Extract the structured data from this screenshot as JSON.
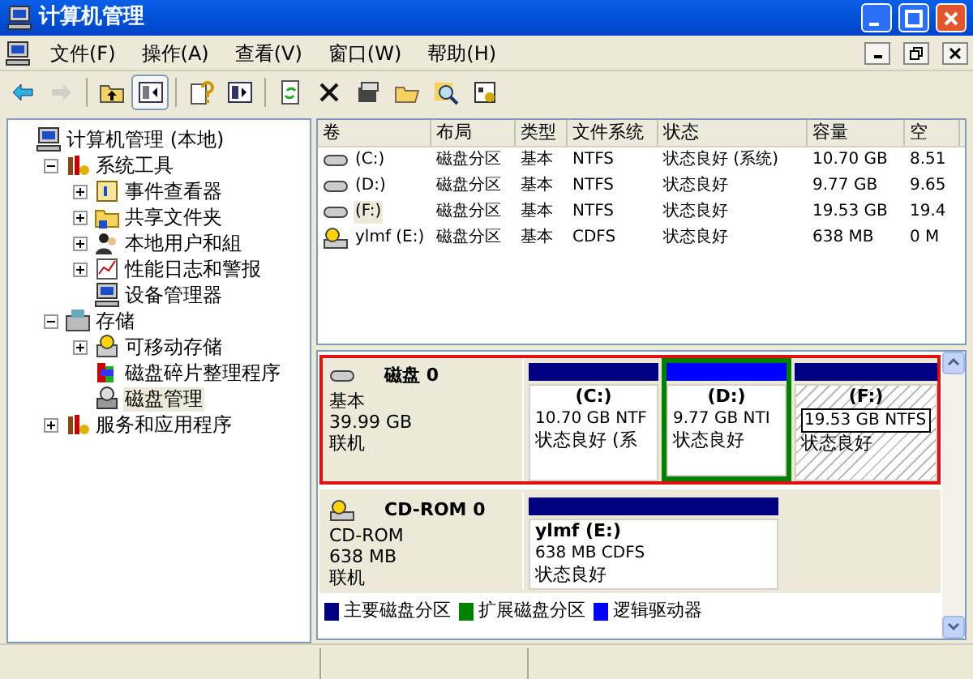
{
  "window": {
    "title": "计算机管理"
  },
  "menu": [
    "文件(F)",
    "操作(A)",
    "查看(V)",
    "窗口(W)",
    "帮助(H)"
  ],
  "toolbar": [
    {
      "kind": "back",
      "disabled": false
    },
    {
      "kind": "forward",
      "disabled": true
    },
    {
      "kind": "up",
      "disabled": false
    },
    {
      "kind": "tree",
      "disabled": false,
      "selected": true
    },
    {
      "kind": "help",
      "disabled": false
    },
    {
      "kind": "panel",
      "disabled": false
    },
    {
      "kind": "refresh",
      "disabled": false
    },
    {
      "kind": "delete",
      "disabled": false
    },
    {
      "kind": "properties",
      "disabled": false
    },
    {
      "kind": "open",
      "disabled": false
    },
    {
      "kind": "search",
      "disabled": false
    },
    {
      "kind": "settings",
      "disabled": false
    }
  ],
  "tree": [
    {
      "label": "计算机管理 (本地)",
      "selected": false,
      "kind": "computer",
      "children": [
        {
          "label": "系统工具",
          "selected": false,
          "expanded": true,
          "kind": "tools",
          "children": [
            {
              "label": "事件查看器",
              "selected": false,
              "expanded": false,
              "kind": "event"
            },
            {
              "label": "共享文件夹",
              "selected": false,
              "expanded": false,
              "kind": "folder"
            },
            {
              "label": "本地用户和組",
              "selected": false,
              "expanded": false,
              "kind": "users"
            },
            {
              "label": "性能日志和警报",
              "selected": false,
              "expanded": false,
              "kind": "chart"
            },
            {
              "label": "设备管理器",
              "selected": false,
              "kind": "computer"
            }
          ]
        },
        {
          "label": "存储",
          "selected": false,
          "expanded": true,
          "kind": "storage",
          "children": [
            {
              "label": "可移动存储",
              "selected": false,
              "expanded": false,
              "kind": "removable"
            },
            {
              "label": "磁盘碎片整理程序",
              "selected": false,
              "kind": "defrag"
            },
            {
              "label": "磁盘管理",
              "selected": true,
              "kind": "disk"
            }
          ]
        },
        {
          "label": "服务和应用程序",
          "selected": false,
          "expanded": false,
          "kind": "tools"
        }
      ]
    }
  ],
  "volumes": {
    "columns": [
      "卷",
      "布局",
      "类型",
      "文件系统",
      "状态",
      "容量",
      "空"
    ],
    "rows": [
      {
        "kind": "disk",
        "selected": false,
        "cells": [
          "(C:)",
          "磁盘分区",
          "基本",
          "NTFS",
          "状态良好 (系统)",
          "10.70 GB",
          "8.51"
        ]
      },
      {
        "kind": "disk",
        "selected": false,
        "cells": [
          "(D:)",
          "磁盘分区",
          "基本",
          "NTFS",
          "状态良好",
          "9.77 GB",
          "9.65"
        ]
      },
      {
        "kind": "disk",
        "selected": true,
        "cells": [
          "(F:)",
          "磁盘分区",
          "基本",
          "NTFS",
          "状态良好",
          "19.53 GB",
          "19.4"
        ]
      },
      {
        "kind": "cd",
        "selected": false,
        "cells": [
          "ylmf (E:)",
          "磁盘分区",
          "基本",
          "CDFS",
          "状态良好",
          "638 MB",
          "0 M"
        ]
      }
    ]
  },
  "disks": [
    {
      "kind": "disk",
      "name": "磁盘 0",
      "type": "基本",
      "size": "39.99 GB",
      "status": "联机",
      "highlighted": true,
      "partitions": [
        {
          "kind": "primary",
          "selected": false,
          "name": "(C:)",
          "size": "10.70 GB NTF",
          "status": "状态良好 (系"
        },
        {
          "kind": "logical",
          "selected": false,
          "name": "(D:)",
          "size": "9.77 GB NTI",
          "status": "状态良好"
        },
        {
          "kind": "primary",
          "selected": true,
          "name": "(F:)",
          "size": "19.53 GB NTFS",
          "status": "状态良好"
        }
      ]
    },
    {
      "kind": "cd",
      "name": "CD-ROM 0",
      "type": "CD-ROM",
      "size": "638 MB",
      "status": "联机",
      "highlighted": false,
      "partitions": [
        {
          "kind": "primary",
          "selected": false,
          "name": "ylmf  (E:)",
          "size": "638 MB CDFS",
          "status": "状态良好"
        }
      ]
    }
  ],
  "legend": [
    {
      "label": "主要磁盘分区",
      "color": "#000080"
    },
    {
      "label": "扩展磁盘分区",
      "color": "#008000"
    },
    {
      "label": "逻辑驱动器",
      "color": "#0000ff"
    }
  ]
}
